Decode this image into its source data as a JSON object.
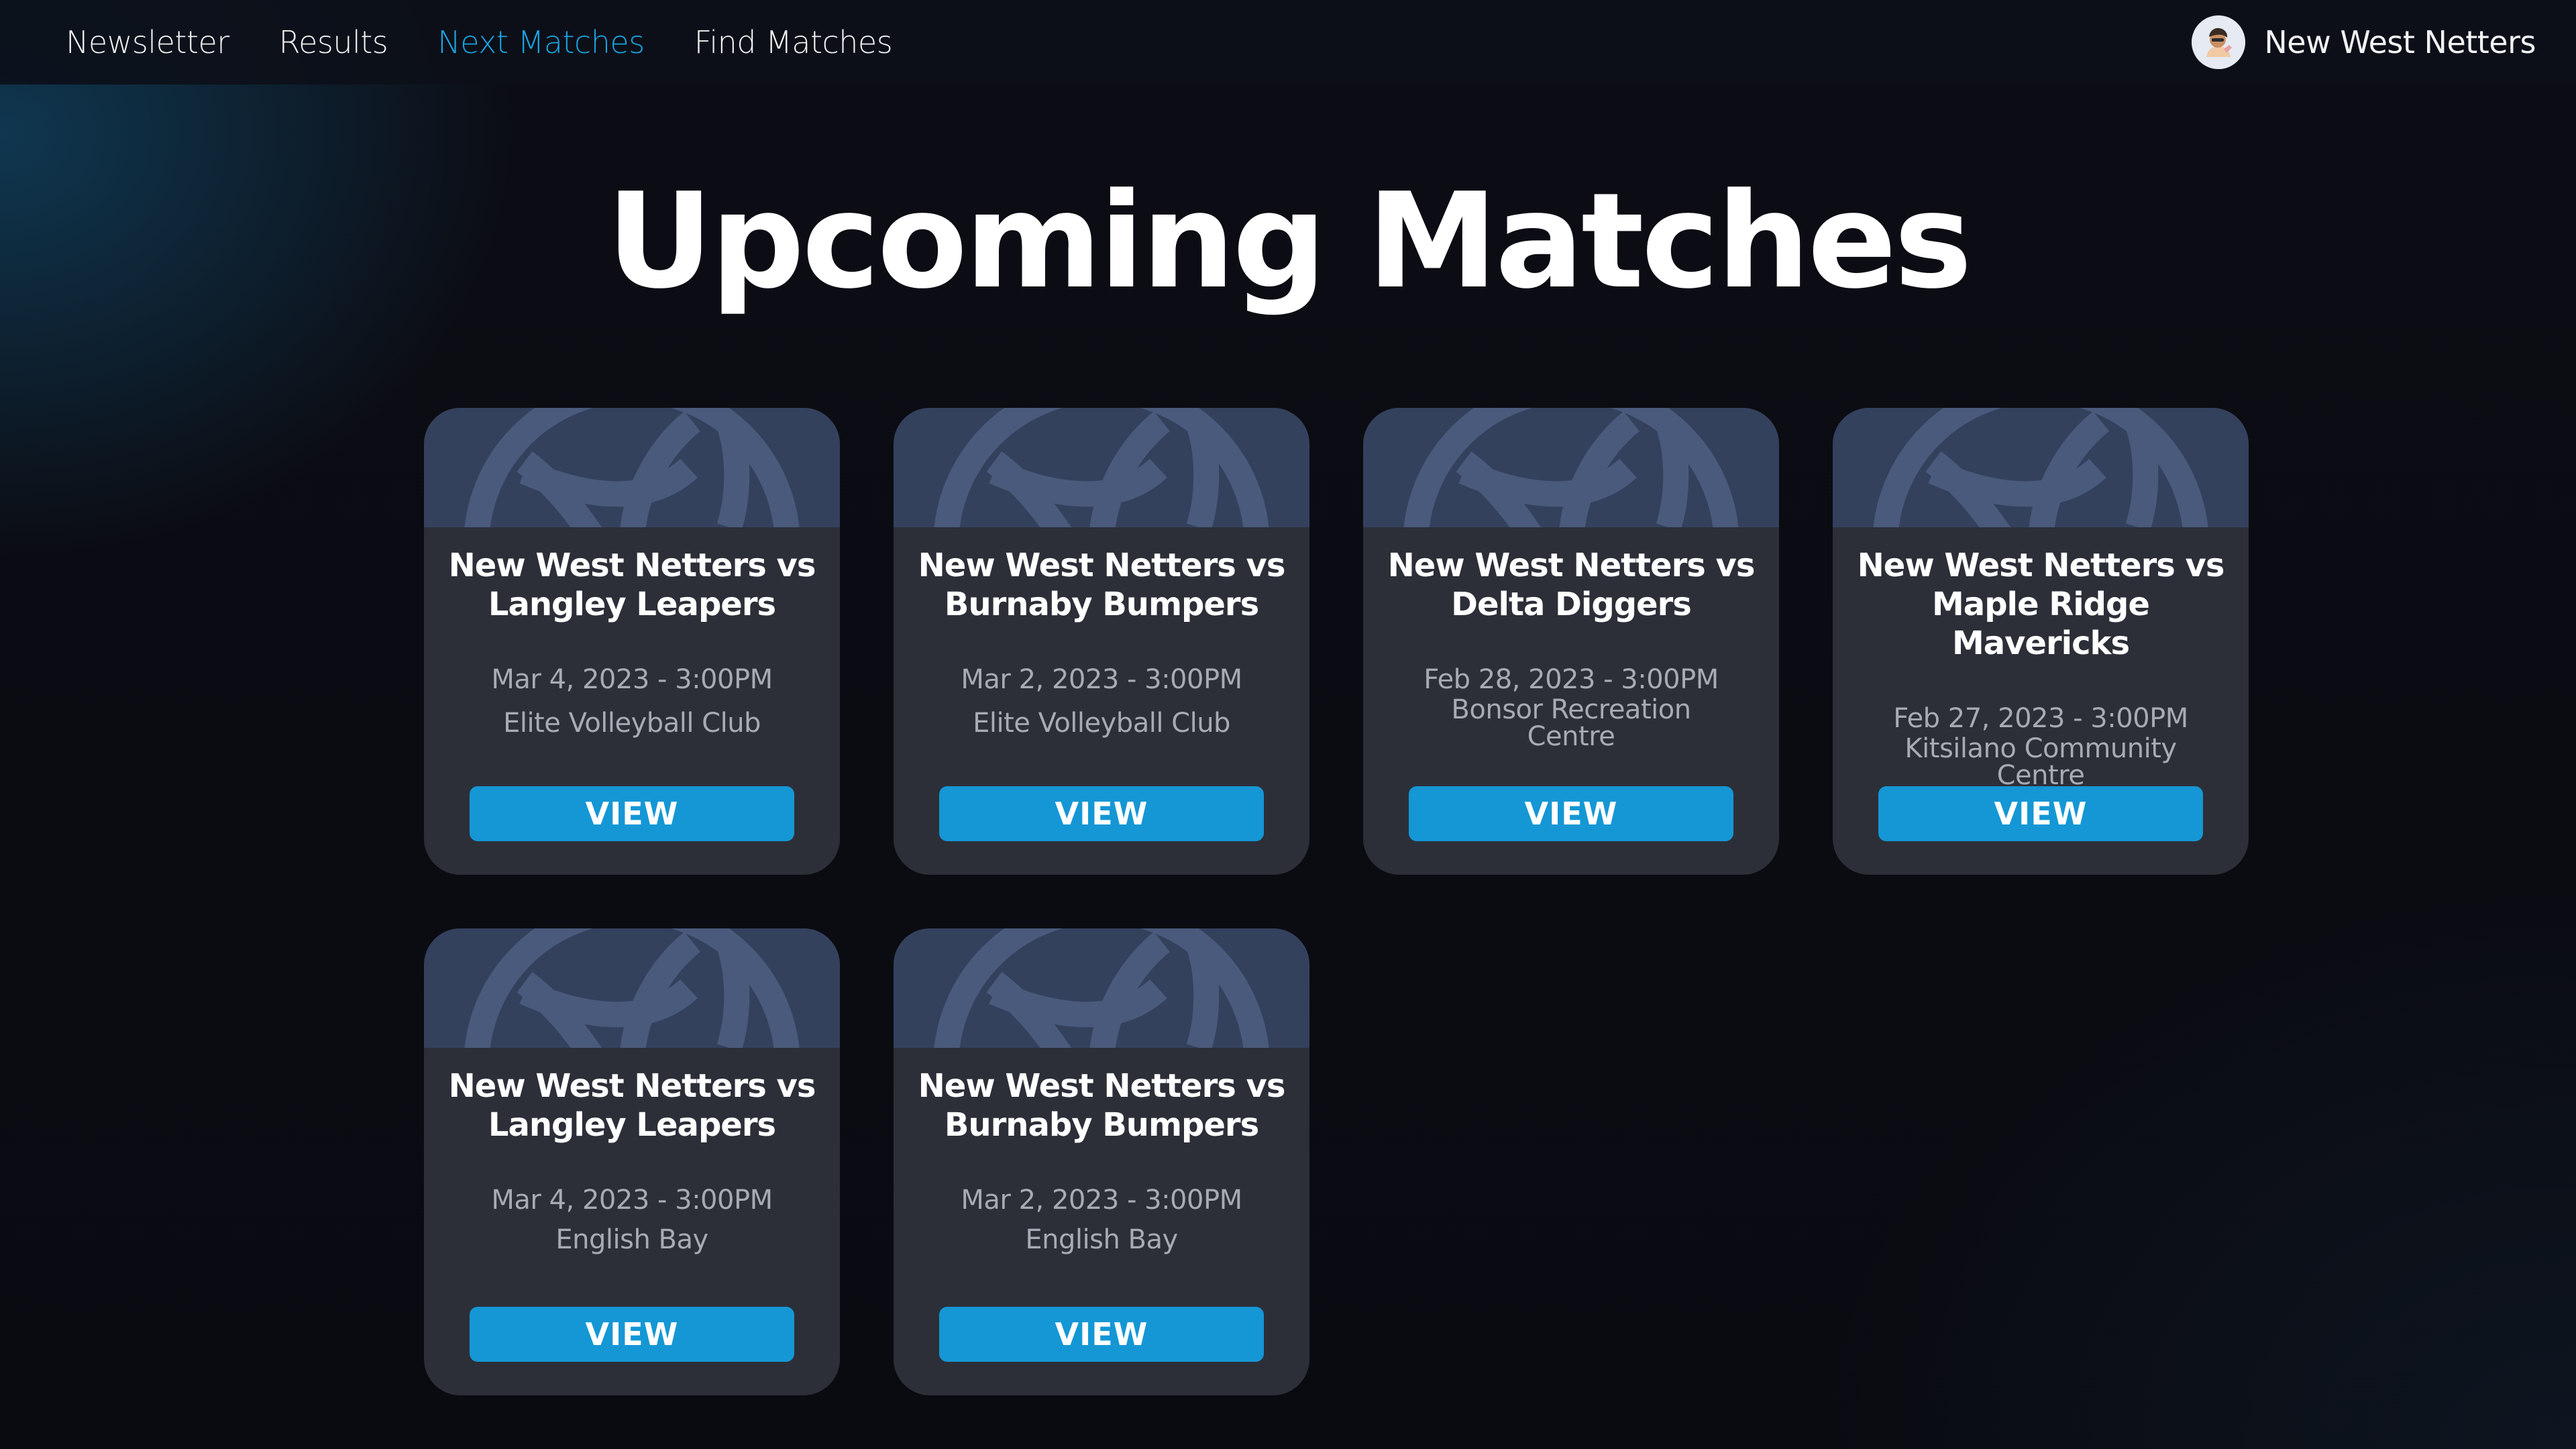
{
  "nav": {
    "links": [
      {
        "label": "Newsletter",
        "active": false
      },
      {
        "label": "Results",
        "active": false
      },
      {
        "label": "Next Matches",
        "active": true
      },
      {
        "label": "Find Matches",
        "active": false
      }
    ],
    "account_name": "New West Netters"
  },
  "page": {
    "title": "Upcoming Matches"
  },
  "matches": [
    {
      "title": "New West Netters vs Langley Leapers",
      "datetime": "Mar 4, 2023 - 3:00PM",
      "venue": "Elite Volleyball Club",
      "button": "VIEW"
    },
    {
      "title": "New West Netters vs Burnaby Bumpers",
      "datetime": "Mar 2, 2023 - 3:00PM",
      "venue": "Elite Volleyball Club",
      "button": "VIEW"
    },
    {
      "title": "New West Netters vs Delta Diggers",
      "datetime": "Feb 28, 2023 - 3:00PM",
      "venue": "Bonsor Recreation Centre",
      "button": "VIEW"
    },
    {
      "title": "New West Netters vs Maple Ridge Mavericks",
      "datetime": "Feb 27, 2023 - 3:00PM",
      "venue": "Kitsilano Community Centre",
      "button": "VIEW"
    },
    {
      "title": "New West Netters vs Langley Leapers",
      "datetime": "Mar 4, 2023 - 3:00PM",
      "venue": "English Bay",
      "button": "VIEW"
    },
    {
      "title": "New West Netters vs Burnaby Bumpers",
      "datetime": "Mar 2, 2023 - 3:00PM",
      "venue": "English Bay",
      "button": "VIEW"
    }
  ],
  "colors": {
    "accent": "#1ba3e0",
    "button": "#1597d5",
    "card": "#2c2f38",
    "banner": "#33415d"
  },
  "icons": {
    "banner": "volleyball-icon",
    "avatar": "user-avatar-icon"
  }
}
